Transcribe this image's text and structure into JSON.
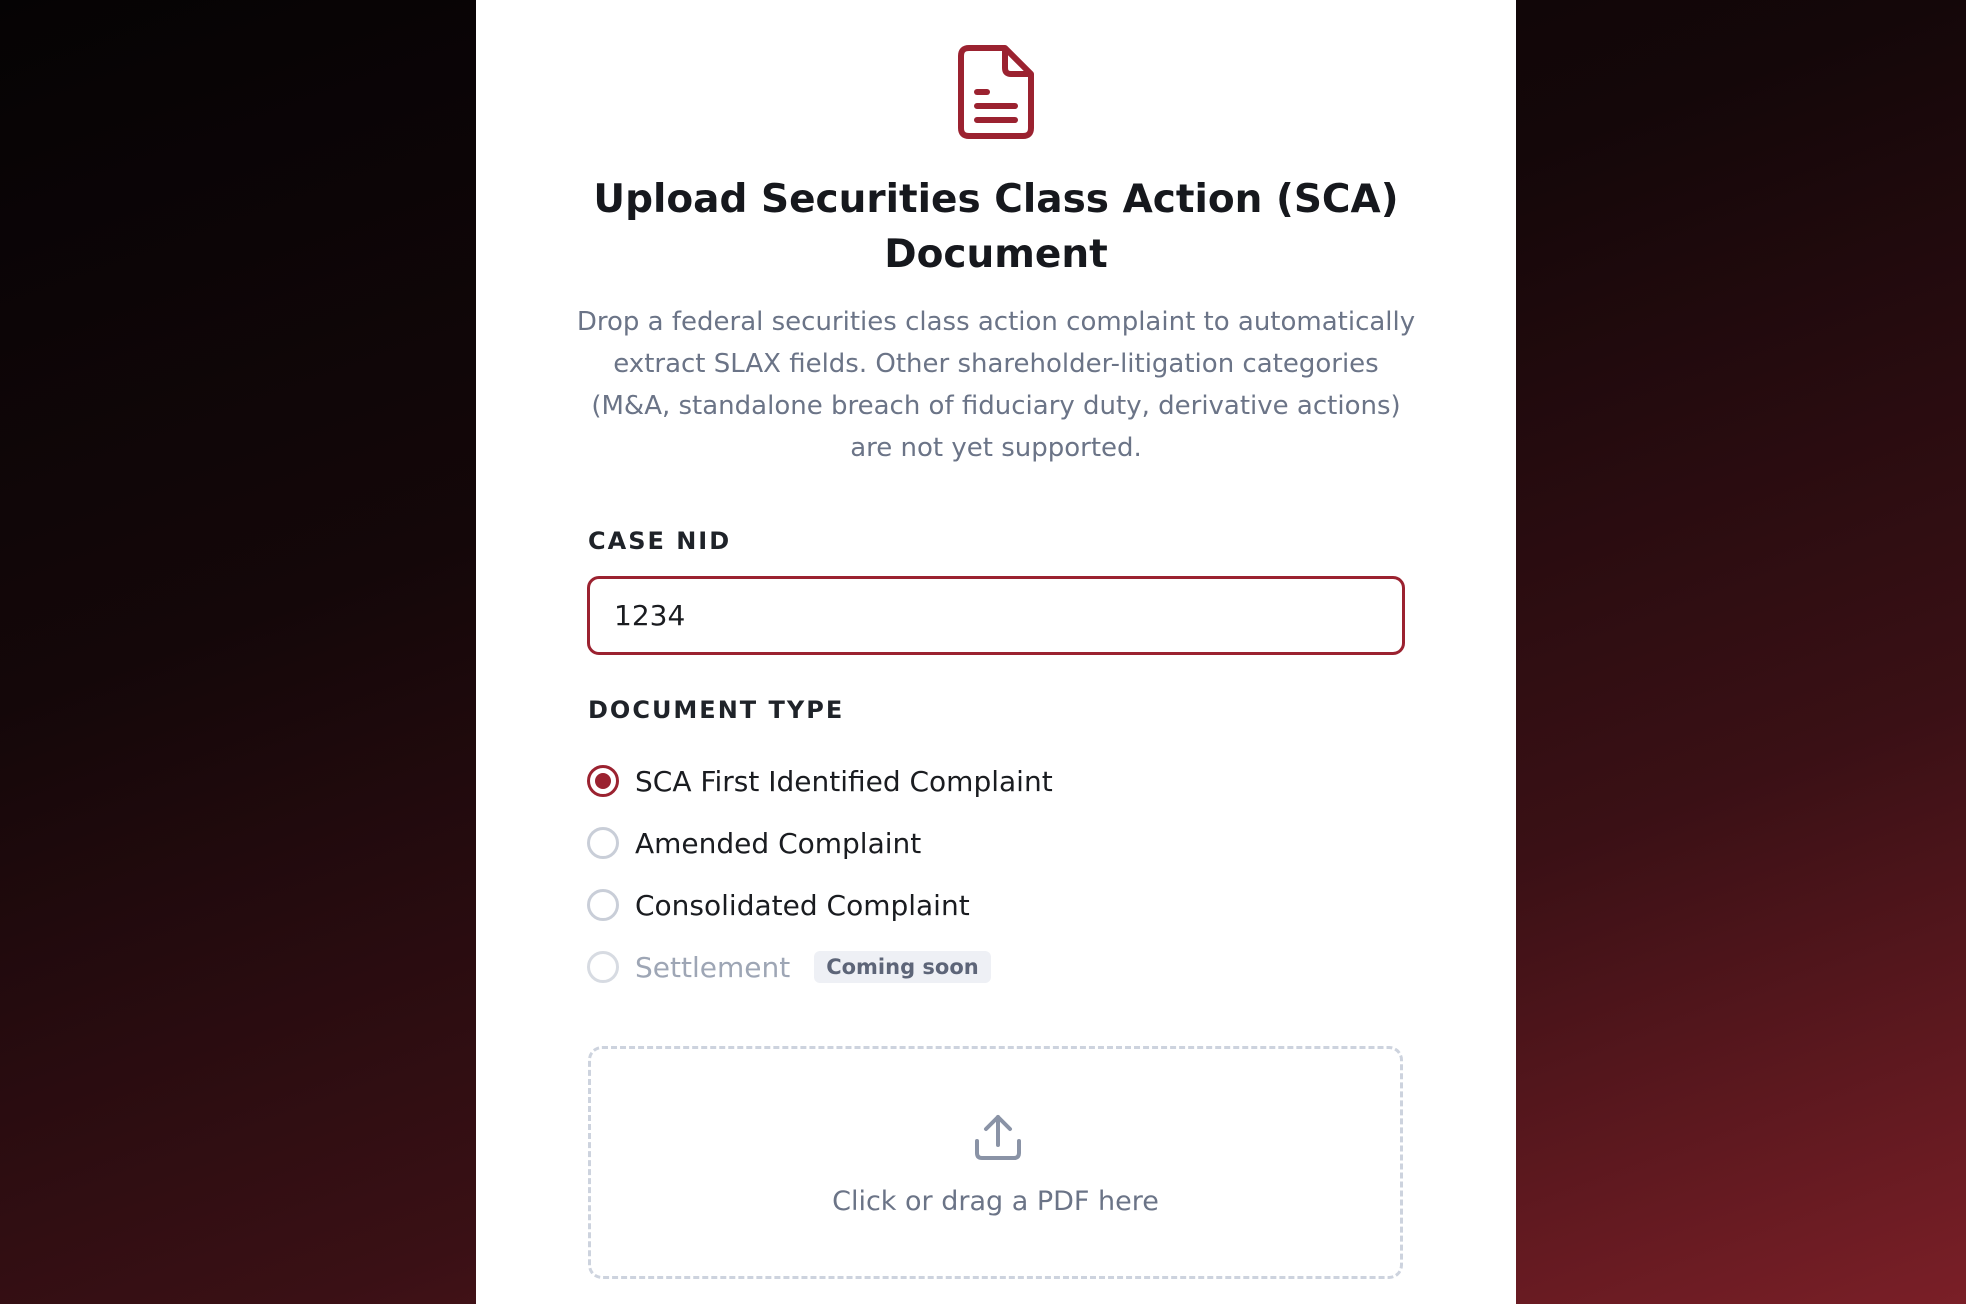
{
  "colors": {
    "accent": "#9b2230",
    "muted_text": "#6b7487",
    "card_background": "#ffffff"
  },
  "header": {
    "icon": "document-text-icon",
    "title": "Upload Securities Class Action (SCA) Document",
    "description": "Drop a federal securities class action complaint to automatically extract SLAX fields. Other shareholder-litigation categories (M&A, standalone breach of fiduciary duty, derivative actions) are not yet supported."
  },
  "case_nid": {
    "label": "CASE NID",
    "value": "1234"
  },
  "document_type": {
    "label": "DOCUMENT TYPE",
    "options": [
      {
        "label": "SCA First Identified Complaint",
        "selected": true,
        "disabled": false
      },
      {
        "label": "Amended Complaint",
        "selected": false,
        "disabled": false
      },
      {
        "label": "Consolidated Complaint",
        "selected": false,
        "disabled": false
      },
      {
        "label": "Settlement",
        "selected": false,
        "disabled": true,
        "badge": "Coming soon"
      }
    ]
  },
  "dropzone": {
    "icon": "upload-icon",
    "text": "Click or drag a PDF here"
  }
}
